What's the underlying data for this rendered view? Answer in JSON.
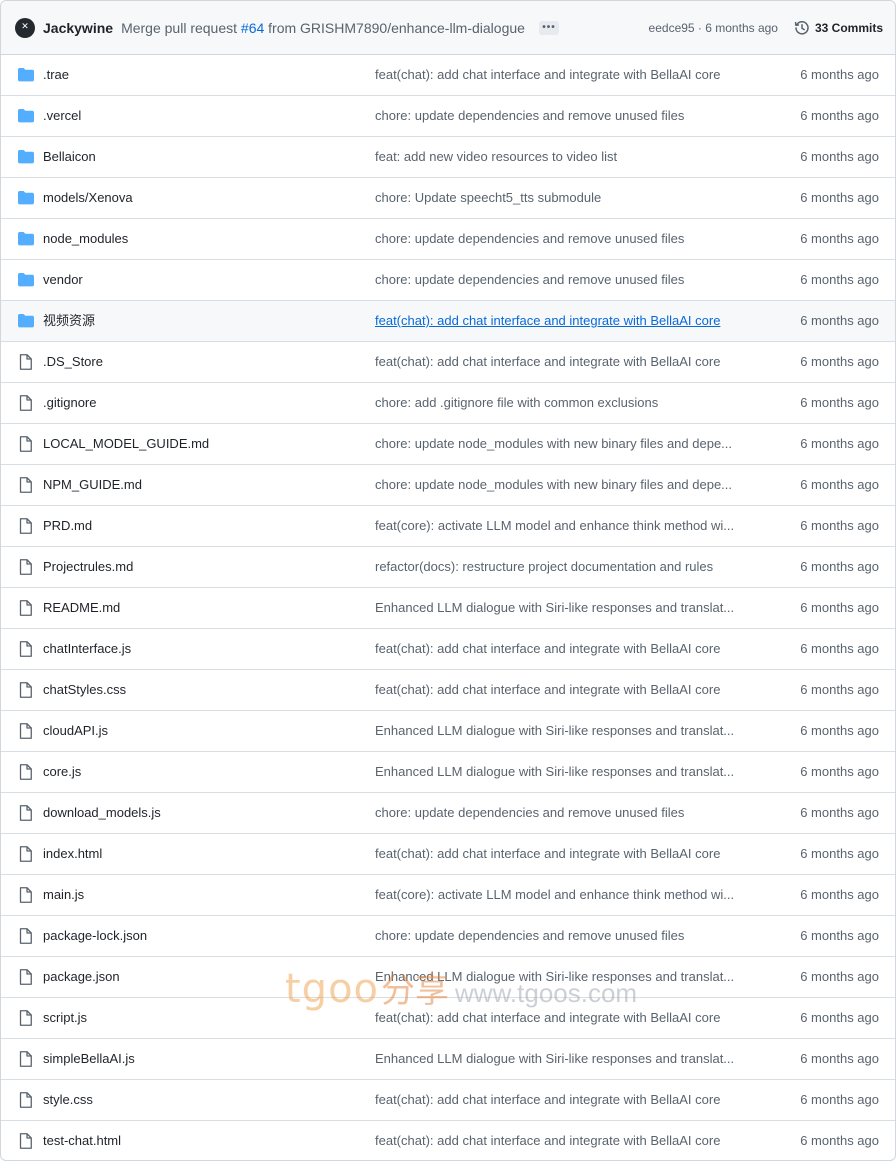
{
  "header": {
    "avatar_glyph": "✕",
    "author": "Jackywine",
    "message_prefix": "Merge pull request",
    "pr_number": "#64",
    "message_suffix": "from GRISHM7890/enhance-llm-dialogue",
    "more_label": "•••",
    "sha_time": "eedce95 · 6 months ago",
    "commits_label": "33 Commits"
  },
  "files": [
    {
      "name": ".trae",
      "type": "folder",
      "message": "feat(chat): add chat interface and integrate with BellaAI core",
      "date": "6 months ago"
    },
    {
      "name": ".vercel",
      "type": "folder",
      "message": "chore: update dependencies and remove unused files",
      "date": "6 months ago"
    },
    {
      "name": "Bellaicon",
      "type": "folder",
      "message": "feat: add new video resources to video list",
      "date": "6 months ago"
    },
    {
      "name": "models/Xenova",
      "type": "folder",
      "message": "chore: Update speecht5_tts submodule",
      "date": "6 months ago"
    },
    {
      "name": "node_modules",
      "type": "folder",
      "message": "chore: update dependencies and remove unused files",
      "date": "6 months ago"
    },
    {
      "name": "vendor",
      "type": "folder",
      "message": "chore: update dependencies and remove unused files",
      "date": "6 months ago"
    },
    {
      "name": "视频资源",
      "type": "folder",
      "message": "feat(chat): add chat interface and integrate with BellaAI core",
      "date": "6 months ago",
      "hovered": true
    },
    {
      "name": ".DS_Store",
      "type": "file",
      "message": "feat(chat): add chat interface and integrate with BellaAI core",
      "date": "6 months ago"
    },
    {
      "name": ".gitignore",
      "type": "file",
      "message": "chore: add .gitignore file with common exclusions",
      "date": "6 months ago"
    },
    {
      "name": "LOCAL_MODEL_GUIDE.md",
      "type": "file",
      "message": "chore: update node_modules with new binary files and depe...",
      "date": "6 months ago"
    },
    {
      "name": "NPM_GUIDE.md",
      "type": "file",
      "message": "chore: update node_modules with new binary files and depe...",
      "date": "6 months ago"
    },
    {
      "name": "PRD.md",
      "type": "file",
      "message": "feat(core): activate LLM model and enhance think method wi...",
      "date": "6 months ago"
    },
    {
      "name": "Projectrules.md",
      "type": "file",
      "message": "refactor(docs): restructure project documentation and rules",
      "date": "6 months ago"
    },
    {
      "name": "README.md",
      "type": "file",
      "message": "Enhanced LLM dialogue with Siri-like responses and translat...",
      "date": "6 months ago"
    },
    {
      "name": "chatInterface.js",
      "type": "file",
      "message": "feat(chat): add chat interface and integrate with BellaAI core",
      "date": "6 months ago"
    },
    {
      "name": "chatStyles.css",
      "type": "file",
      "message": "feat(chat): add chat interface and integrate with BellaAI core",
      "date": "6 months ago"
    },
    {
      "name": "cloudAPI.js",
      "type": "file",
      "message": "Enhanced LLM dialogue with Siri-like responses and translat...",
      "date": "6 months ago"
    },
    {
      "name": "core.js",
      "type": "file",
      "message": "Enhanced LLM dialogue with Siri-like responses and translat...",
      "date": "6 months ago"
    },
    {
      "name": "download_models.js",
      "type": "file",
      "message": "chore: update dependencies and remove unused files",
      "date": "6 months ago"
    },
    {
      "name": "index.html",
      "type": "file",
      "message": "feat(chat): add chat interface and integrate with BellaAI core",
      "date": "6 months ago"
    },
    {
      "name": "main.js",
      "type": "file",
      "message": "feat(core): activate LLM model and enhance think method wi...",
      "date": "6 months ago"
    },
    {
      "name": "package-lock.json",
      "type": "file",
      "message": "chore: update dependencies and remove unused files",
      "date": "6 months ago"
    },
    {
      "name": "package.json",
      "type": "file",
      "message": "Enhanced LLM dialogue with Siri-like responses and translat...",
      "date": "6 months ago"
    },
    {
      "name": "script.js",
      "type": "file",
      "message": "feat(chat): add chat interface and integrate with BellaAI core",
      "date": "6 months ago"
    },
    {
      "name": "simpleBellaAI.js",
      "type": "file",
      "message": "Enhanced LLM dialogue with Siri-like responses and translat...",
      "date": "6 months ago"
    },
    {
      "name": "style.css",
      "type": "file",
      "message": "feat(chat): add chat interface and integrate with BellaAI core",
      "date": "6 months ago"
    },
    {
      "name": "test-chat.html",
      "type": "file",
      "message": "feat(chat): add chat interface and integrate with BellaAI core",
      "date": "6 months ago"
    }
  ],
  "watermark": {
    "brand": "tgoo",
    "cn": "分享",
    "url": "www.tgoos.com"
  },
  "colors": {
    "folder": "#54aeff",
    "file_icon": "#59636e",
    "link": "#0969da",
    "muted": "#59636e",
    "header_bg": "#f6f8fa"
  },
  "icons": {
    "folder": "folder-icon",
    "file": "file-icon",
    "history": "history-icon",
    "more": "kebab-horizontal-icon"
  }
}
